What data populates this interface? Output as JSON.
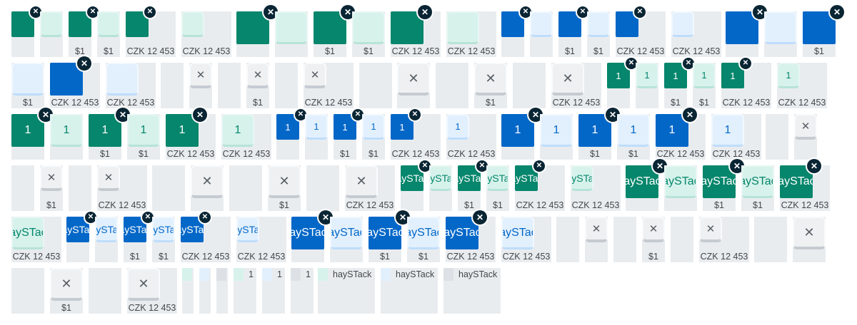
{
  "colors": {
    "green_solid": "#06866c",
    "green_tint": "#d6f2eb",
    "blue_solid": "#0367c8",
    "blue_tint": "#e2f0fd",
    "grey_tint": "#eef0f2",
    "remove_badge": "#0a2533",
    "cell_background": "#e9ecef"
  },
  "icons": {
    "remove": "circled-x-icon",
    "close": "x-icon"
  },
  "glyphs": {
    "remove": "✕",
    "close": "✕"
  },
  "captions": {
    "dollar": "$1",
    "czk": "CZK 12 453"
  },
  "tile_labels": {
    "one": "1",
    "haystack": "haySTack"
  },
  "swatch_legend": [
    {
      "label": "1",
      "color": "#d6f2eb"
    },
    {
      "label": "1",
      "color": "#e2f0fd"
    },
    {
      "label": "1",
      "color": "#dde1e5"
    },
    {
      "label": "haySTack",
      "color": "#d6f2eb"
    },
    {
      "label": "haySTack",
      "color": "#e2f0fd"
    },
    {
      "label": "haySTack",
      "color": "#dde1e5"
    }
  ]
}
